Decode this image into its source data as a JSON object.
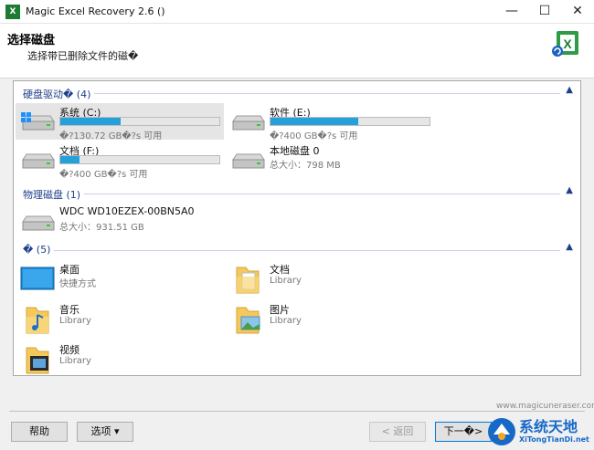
{
  "window": {
    "title": "Magic Excel Recovery 2.6 ()",
    "minimize": "—",
    "maximize": "☐",
    "close": "✕"
  },
  "header": {
    "title": "选择磁盘",
    "subtitle": "选择带已删除文件的磁�"
  },
  "sections": {
    "hard_drives": "硬盘驱动� (4)",
    "physical": "物理磁盘 (1)",
    "other": "� (5)"
  },
  "drives": [
    {
      "name": "系统 (C:)",
      "info": "�?130.72 GB�?s 可用",
      "fill": 0.38
    },
    {
      "name": "软件 (E:)",
      "info": "�?400 GB�?s 可用",
      "fill": 0.55
    },
    {
      "name": "文档 (F:)",
      "info": "�?400 GB�?s 可用",
      "fill": 0.12
    },
    {
      "name": "本地磁盘 0",
      "info": "总大小：798 MB"
    }
  ],
  "physical_disks": [
    {
      "name": "WDC WD10EZEX-00BN5A0",
      "info": "总大小：931.51 GB"
    }
  ],
  "folders": [
    {
      "name": "桌面",
      "info": "快捷方式"
    },
    {
      "name": "文档",
      "info": "Library"
    },
    {
      "name": "音乐",
      "info": "Library"
    },
    {
      "name": "图片",
      "info": "Library"
    },
    {
      "name": "视频",
      "info": "Library"
    }
  ],
  "footer": {
    "website": "www.magicuneraser.com",
    "help": "帮助",
    "options": "选项 ▾",
    "back": "< 返回",
    "next": "下一�>"
  },
  "brand": {
    "name": "系统天地",
    "url": "XiTongTianDi.net"
  },
  "colors": {
    "accent": "#26a0da",
    "section_text": "#1e3f8a",
    "excel_green": "#1e7b34"
  }
}
